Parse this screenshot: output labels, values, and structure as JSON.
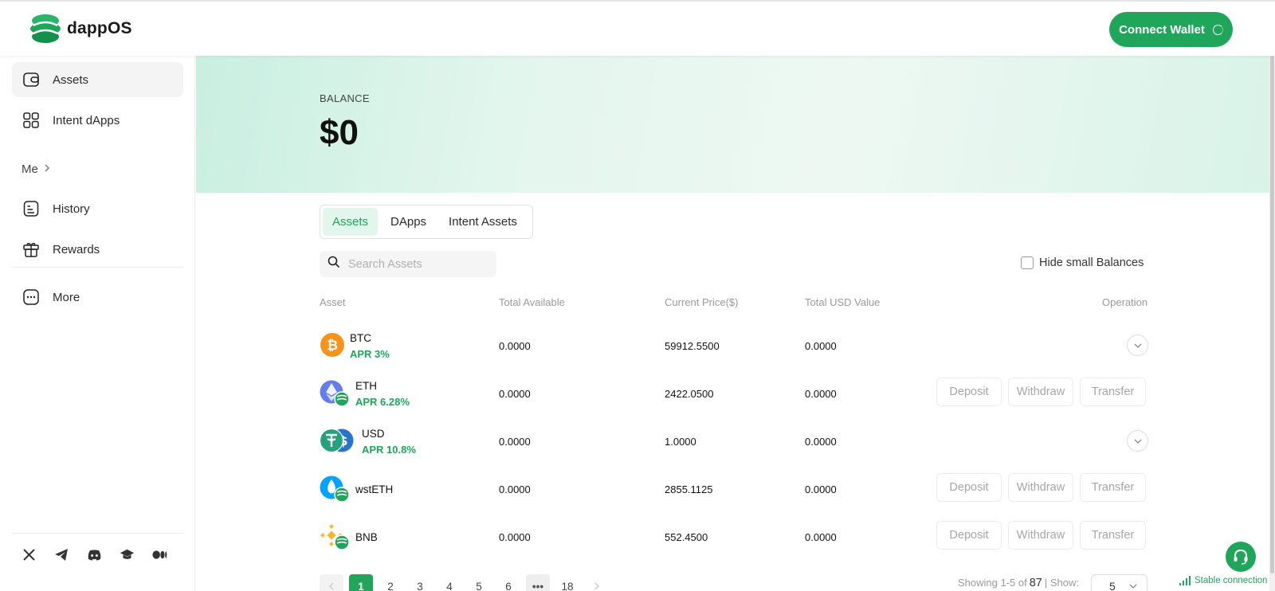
{
  "brand": {
    "name": "dappOS",
    "accent": "#1fa65a"
  },
  "header": {
    "connect_label": "Connect Wallet"
  },
  "sidebar": {
    "items": [
      {
        "label": "Assets",
        "icon": "wallet-icon"
      },
      {
        "label": "Intent dApps",
        "icon": "grid-icon"
      }
    ],
    "me_label": "Me",
    "me_items": [
      {
        "label": "History",
        "icon": "history-icon"
      },
      {
        "label": "Rewards",
        "icon": "gift-icon"
      }
    ],
    "more_label": "More",
    "socials": [
      "x-icon",
      "telegram-icon",
      "discord-icon",
      "graduation-cap-icon",
      "medium-icon"
    ]
  },
  "balance": {
    "label": "BALANCE",
    "value": "$0"
  },
  "tabs": [
    {
      "label": "Assets",
      "active": true
    },
    {
      "label": "DApps",
      "active": false
    },
    {
      "label": "Intent Assets",
      "active": false
    }
  ],
  "search": {
    "placeholder": "Search Assets",
    "value": ""
  },
  "hide_small_label": "Hide small Balances",
  "table": {
    "headers": {
      "asset": "Asset",
      "available": "Total Available",
      "price": "Current Price($)",
      "usd": "Total USD Value",
      "operation": "Operation"
    },
    "rows": [
      {
        "name": "BTC",
        "apr": "APR 3%",
        "available": "0.0000",
        "price": "59912.5500",
        "usd": "0.0000",
        "ops": "expand"
      },
      {
        "name": "ETH",
        "apr": "APR 6.28%",
        "available": "0.0000",
        "price": "2422.0500",
        "usd": "0.0000",
        "ops": "buttons"
      },
      {
        "name": "USD",
        "apr": "APR 10.8%",
        "available": "0.0000",
        "price": "1.0000",
        "usd": "0.0000",
        "ops": "expand"
      },
      {
        "name": "wstETH",
        "apr": "",
        "available": "0.0000",
        "price": "2855.1125",
        "usd": "0.0000",
        "ops": "buttons"
      },
      {
        "name": "BNB",
        "apr": "",
        "available": "0.0000",
        "price": "552.4500",
        "usd": "0.0000",
        "ops": "buttons"
      }
    ],
    "op_labels": {
      "deposit": "Deposit",
      "withdraw": "Withdraw",
      "transfer": "Transfer"
    }
  },
  "pagination": {
    "pages": [
      "1",
      "2",
      "3",
      "4",
      "5",
      "6"
    ],
    "ellipsis": "•••",
    "last": "18",
    "showing_prefix": "Showing 1-5 of",
    "total": "87",
    "show_label": "| Show:",
    "page_size": "5"
  },
  "status": {
    "connection": "Stable connection"
  }
}
